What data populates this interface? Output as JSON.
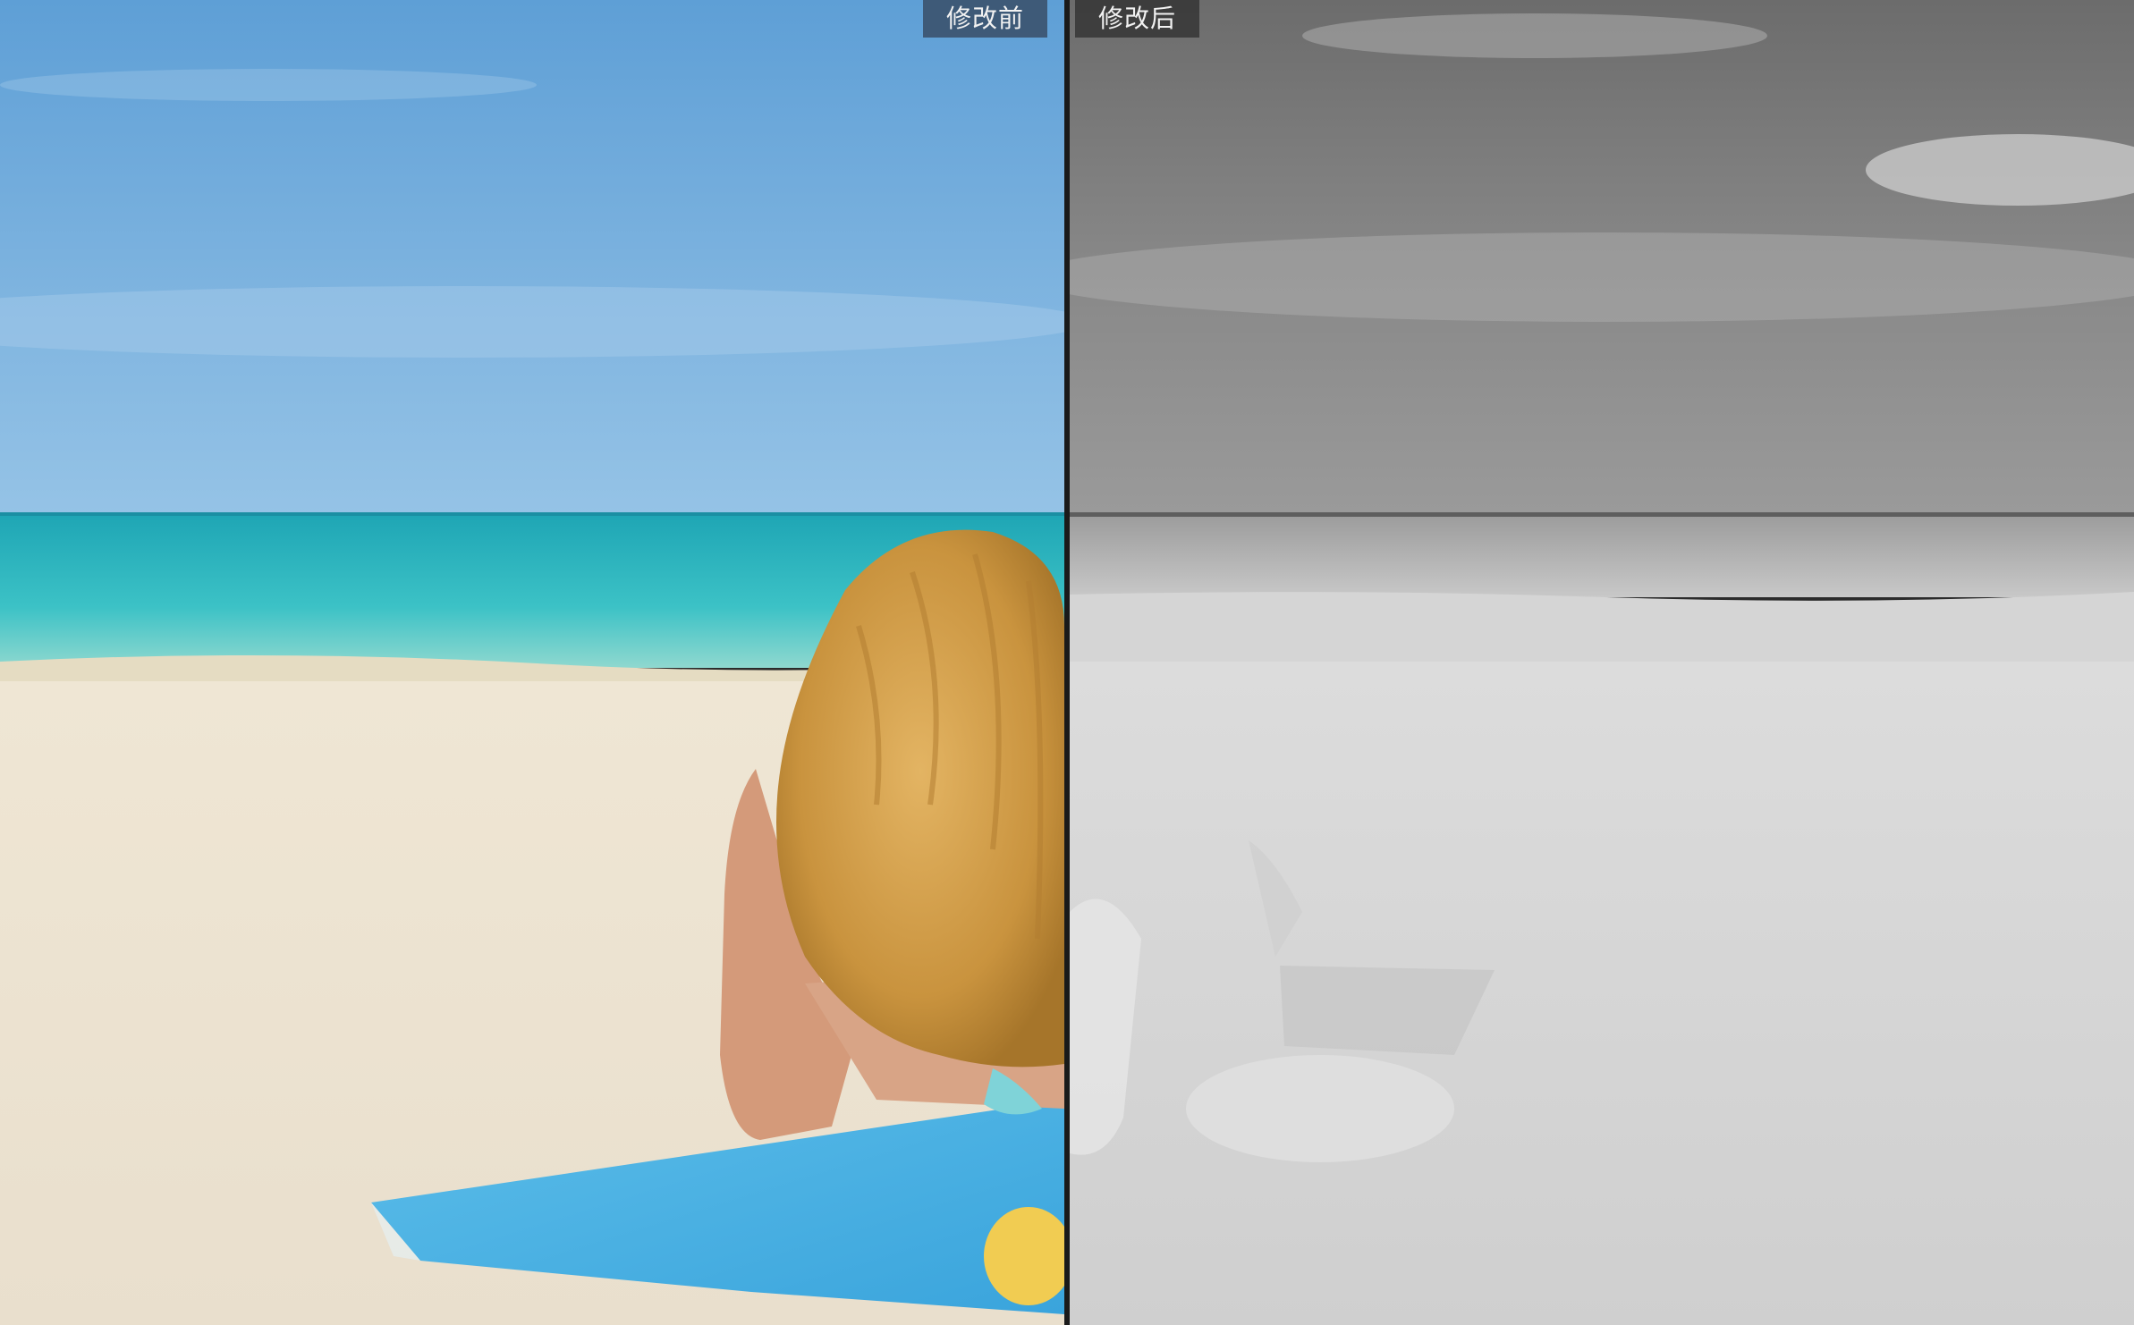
{
  "compare": {
    "before_label": "修改前",
    "after_label": "修改后"
  },
  "image": {
    "subject": "beach-scene",
    "after_filter": "grayscale"
  }
}
